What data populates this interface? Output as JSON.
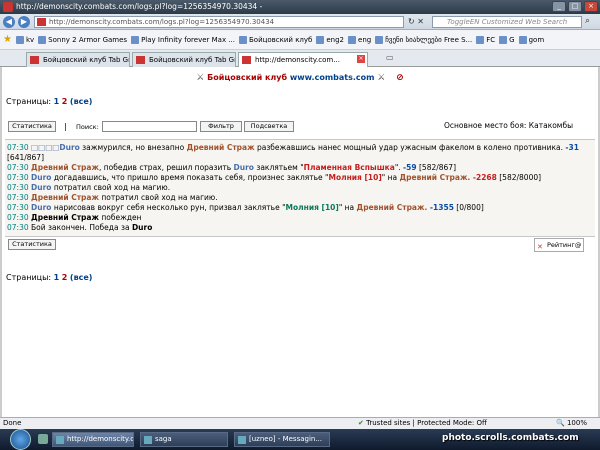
{
  "window": {
    "title": "http://demonscity.combats.com/logs.pl?log=1256354970.30434 -"
  },
  "address": {
    "url": "http://demonscity.combats.com/logs.pl?log=1256354970.30434",
    "search_placeholder": "ToggleEN Customized Web Search"
  },
  "favorites": [
    {
      "label": "kv"
    },
    {
      "label": "Sonny 2 Armor Games"
    },
    {
      "label": "Play Infinity forever Max ..."
    },
    {
      "label": "Бойцовский клуб"
    },
    {
      "label": "eng2"
    },
    {
      "label": "eng"
    },
    {
      "label": "ჩვენი სიახლეები Free S..."
    },
    {
      "label": "FC"
    },
    {
      "label": "G"
    },
    {
      "label": "gom"
    }
  ],
  "tabs": [
    {
      "label": "Бойцовский клуб Tab Gro..."
    },
    {
      "label": "Бойцовский клуб Tab Gro..."
    },
    {
      "label": "http://demonscity.com..."
    }
  ],
  "page": {
    "club": "Бойцовский клуб",
    "site": "www.combats.com",
    "pages_label": "Страницы:",
    "page1": "1",
    "page2": "2",
    "all": "(все)",
    "stats_button": "Статистика",
    "sep": "|",
    "search_label": "Поиск:",
    "filter_button": "Фильтр",
    "highlight_button": "Подсветка",
    "location": "Основное место боя: Катакомбы",
    "rating_button": "Рейтинг@"
  },
  "log": {
    "l1": {
      "time": "07:30",
      "boxes": "□□□□",
      "name": "Duro",
      "t1": " зажмурился, но внезапно ",
      "target": "Древний Страж",
      "t2": " разбежавшись нанес мощный удар ужасным факелом в колено противника. ",
      "dmg": "-31",
      "hp": " [641/867]"
    },
    "l2": {
      "time": "07:30",
      "name": "Древний Страж",
      "t1": ", победив страх, решил поразить ",
      "target": "Duro",
      "t2": " заклятьем \"",
      "spell": "Пламенная Вспышка",
      "t3": "\". ",
      "dmg": "-59",
      "hp": " [582/867]"
    },
    "l3": {
      "time": "07:30",
      "name": "Duro",
      "t1": " догадавшись, что пришло время показать себя, произнес заклятье \"",
      "spell": "Молния [10]",
      "t2": "\" на ",
      "target": "Древний Страж.",
      "dmg": " -2268",
      "hp": " [582/8000]"
    },
    "l4": {
      "time": "07:30",
      "name": "Duro",
      "t1": " потратил свой ход на магию."
    },
    "l5": {
      "time": "07:30",
      "name": "Древний Страж",
      "t1": " потратил свой ход на магию."
    },
    "l6": {
      "time": "07:30",
      "name": "Duro",
      "t1": " нарисовав вокруг себя несколько рун, призвал заклятье \"",
      "spell": "Молния [10]",
      "t2": "\" на ",
      "target": "Древний Страж.",
      "dmg": " -1355",
      "hp": " [0/800]"
    },
    "l7": {
      "time": "07:30",
      "name": "Древний Страж",
      "t1": " побежден"
    },
    "l8": {
      "time": "07:30",
      "t1": " Бой закончен. Победа за ",
      "name": "Duro"
    }
  },
  "status": {
    "left": "Done",
    "zone": "Trusted sites | Protected Mode: Off",
    "zoom": "100%"
  },
  "taskbar": {
    "items": [
      {
        "label": "http://demonscity.c..."
      },
      {
        "label": "saga"
      },
      {
        "label": "[uzneo] - Messagin..."
      }
    ],
    "tray": "photo.scrolls.combats.com"
  }
}
